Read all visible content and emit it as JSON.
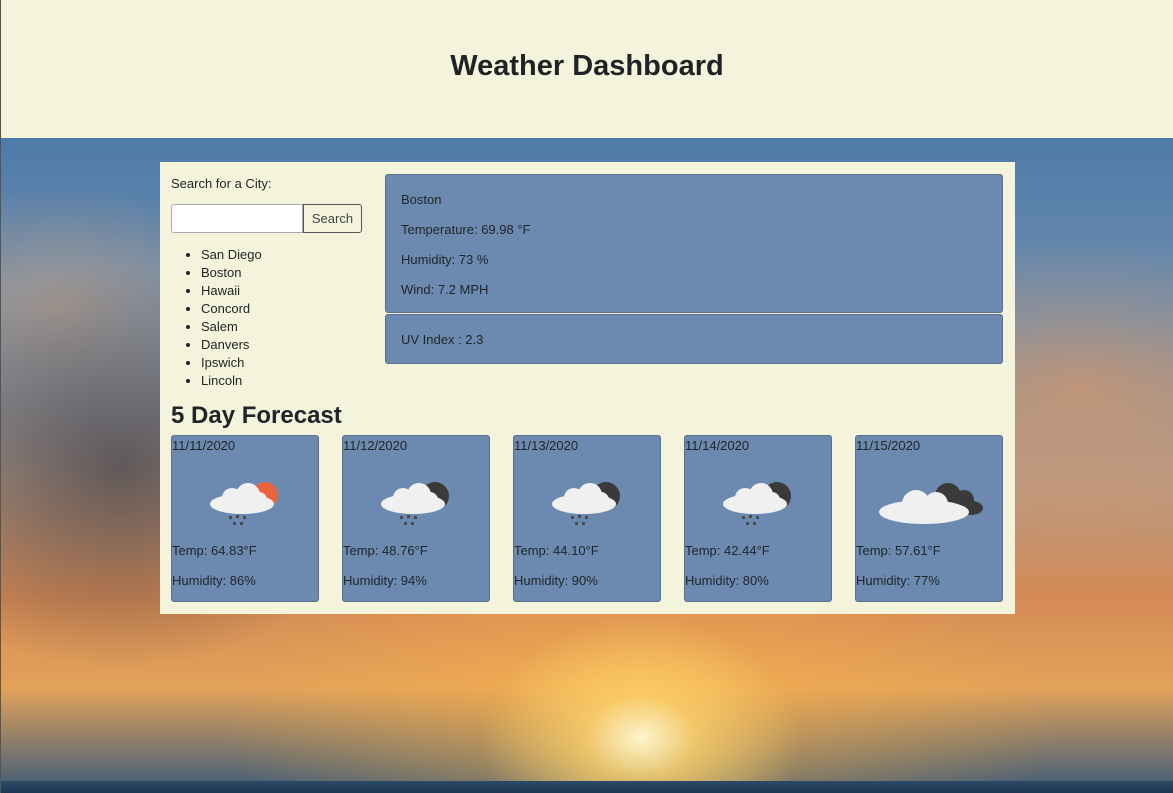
{
  "app": {
    "title": "Weather Dashboard"
  },
  "search": {
    "label": "Search for a City:",
    "placeholder": "",
    "value": "",
    "button_label": "Search"
  },
  "history": [
    "San Diego",
    "Boston",
    "Hawaii",
    "Concord",
    "Salem",
    "Danvers",
    "Ipswich",
    "Lincoln"
  ],
  "current": {
    "city": "Boston",
    "temperature": "Temperature: 69.98 °F",
    "humidity": "Humidity: 73 %",
    "wind": "Wind: 7.2 MPH",
    "uv": "UV Index : 2.3"
  },
  "forecast": {
    "title": "5 Day Forecast",
    "days": [
      {
        "date": "11/11/2020",
        "icon": "sun-cloud-rain-icon",
        "temp": "Temp: 64.83°F",
        "humidity": "Humidity: 86%"
      },
      {
        "date": "11/12/2020",
        "icon": "dark-cloud-rain-icon",
        "temp": "Temp: 48.76°F",
        "humidity": "Humidity: 94%"
      },
      {
        "date": "11/13/2020",
        "icon": "dark-cloud-rain-icon",
        "temp": "Temp: 44.10°F",
        "humidity": "Humidity: 90%"
      },
      {
        "date": "11/14/2020",
        "icon": "dark-cloud-rain-icon",
        "temp": "Temp: 42.44°F",
        "humidity": "Humidity: 80%"
      },
      {
        "date": "11/15/2020",
        "icon": "broken-clouds-icon",
        "temp": "Temp: 57.61°F",
        "humidity": "Humidity: 77%"
      }
    ]
  },
  "colors": {
    "page_bg": "#f3f4db",
    "card_bg": "#6c8ab0",
    "accent_sun": "#e8643c",
    "dark_cloud": "#3a3a3a"
  }
}
